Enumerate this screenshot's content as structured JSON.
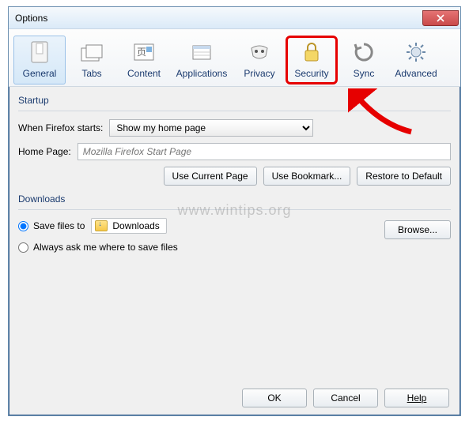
{
  "window": {
    "title": "Options"
  },
  "toolbar": {
    "general": "General",
    "tabs": "Tabs",
    "content": "Content",
    "applications": "Applications",
    "privacy": "Privacy",
    "security": "Security",
    "sync": "Sync",
    "advanced": "Advanced"
  },
  "startup": {
    "heading": "Startup",
    "when_label": "When Firefox starts:",
    "when_value": "Show my home page",
    "home_label": "Home Page:",
    "home_placeholder": "Mozilla Firefox Start Page",
    "use_current": "Use Current Page",
    "use_bookmark": "Use Bookmark...",
    "restore": "Restore to Default"
  },
  "downloads": {
    "heading": "Downloads",
    "save_label": "Save files to",
    "folder": "Downloads",
    "browse": "Browse...",
    "ask_label": "Always ask me where to save files"
  },
  "footer": {
    "ok": "OK",
    "cancel": "Cancel",
    "help": "Help"
  },
  "watermark": "www.wintips.org"
}
